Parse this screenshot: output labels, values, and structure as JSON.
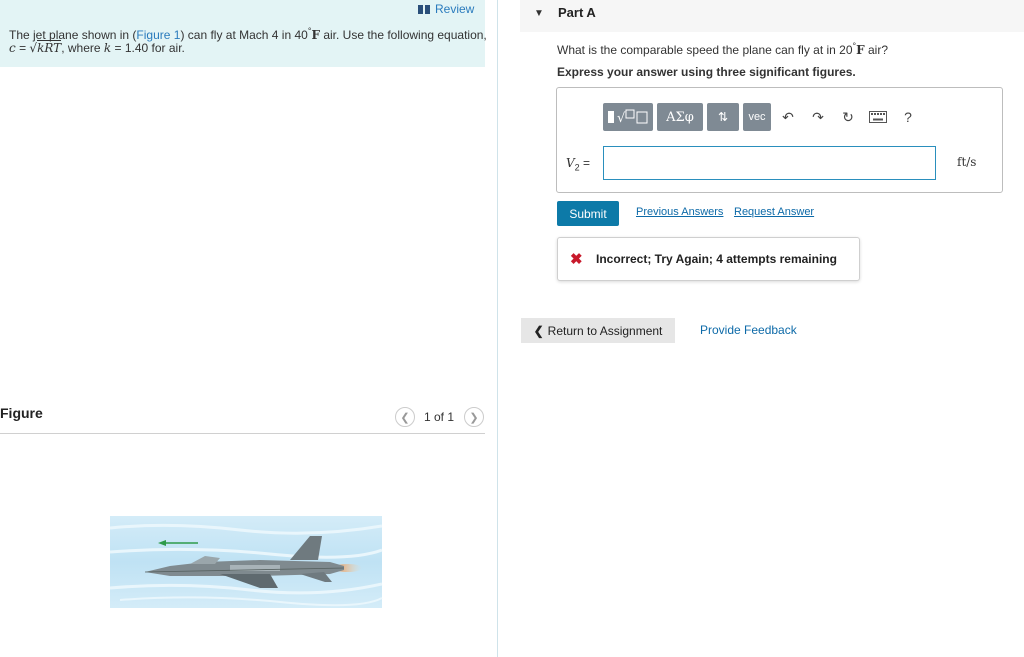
{
  "review": {
    "label": "Review",
    "icon": "book-icon"
  },
  "intro": {
    "line1_a": "The jet plane shown in (",
    "figure_link": "Figure 1",
    "line1_b": ") can fly at Mach 4 in 40",
    "line1_deg": "°",
    "line1_F": "F",
    "line1_c": " air. Use the following equation,",
    "c_var": "c",
    "equals": " = ",
    "sqrt_sym": "√",
    "sqrt_content": "kRT",
    "line2_where": ", where ",
    "k_var": "k",
    "line2_value": " = 1.40 for air."
  },
  "figure": {
    "title": "Figure",
    "pager_text": "1 of 1",
    "prev_icon": "chevron-left-icon",
    "next_icon": "chevron-right-icon"
  },
  "part": {
    "label": "Part A",
    "caret_icon": "caret-down-icon"
  },
  "question": {
    "text_a": "What is the comparable speed the plane can fly at in 20",
    "deg": "°",
    "F": "F",
    "text_b": " air?",
    "instruction": "Express your answer using three significant figures."
  },
  "toolbar": {
    "greek": "ΑΣφ",
    "arrows": "⇅",
    "vec": "vec",
    "undo": "↶",
    "redo": "↷",
    "reset": "↻",
    "help": "?"
  },
  "answer": {
    "var_V": "V",
    "var_sub": "2",
    "var_eq": " =",
    "value": "",
    "unit": "ft/s"
  },
  "actions": {
    "submit": "Submit",
    "previous_answers": "Previous Answers",
    "request_answer": "Request Answer"
  },
  "result": {
    "icon": "x-icon",
    "message": "Incorrect; Try Again; 4 attempts remaining"
  },
  "footer": {
    "return_label": "Return to Assignment",
    "provide_feedback": "Provide Feedback"
  },
  "colors": {
    "intro_bg": "#e3f4f5",
    "link": "#2a7bbd",
    "submit_bg": "#0d7aa8",
    "error": "#c8192b",
    "toolbar_btn": "#7f8a94"
  }
}
